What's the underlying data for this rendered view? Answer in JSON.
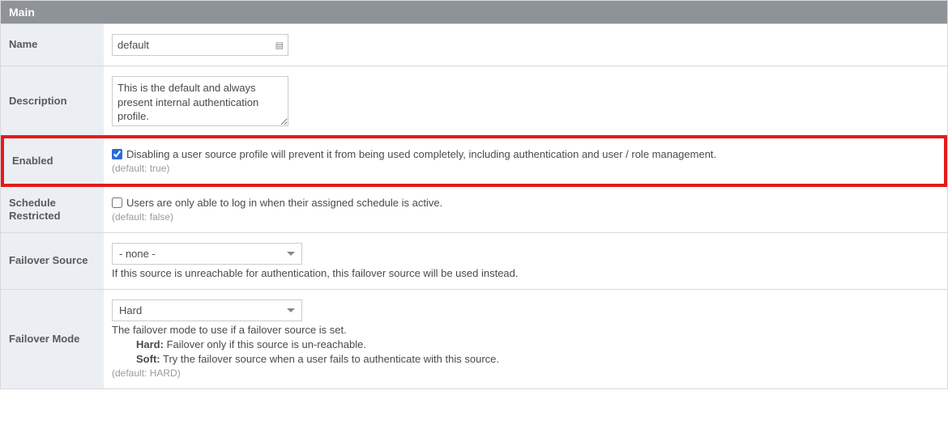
{
  "panel": {
    "title": "Main"
  },
  "fields": {
    "name": {
      "label": "Name",
      "value": "default"
    },
    "description": {
      "label": "Description",
      "value": "This is the default and always present internal authentication profile."
    },
    "enabled": {
      "label": "Enabled",
      "checked": true,
      "desc": "Disabling a user source profile will prevent it from being used completely, including authentication and user / role management.",
      "default_text": "(default: true)"
    },
    "schedule_restricted": {
      "label": "Schedule Restricted",
      "checked": false,
      "desc": "Users are only able to log in when their assigned schedule is active.",
      "default_text": "(default: false)"
    },
    "failover_source": {
      "label": "Failover Source",
      "selected": "- none -",
      "desc": "If this source is unreachable for authentication, this failover source will be used instead."
    },
    "failover_mode": {
      "label": "Failover Mode",
      "selected": "Hard",
      "desc": "The failover mode to use if a failover source is set.",
      "hard_label": "Hard:",
      "hard_desc": " Failover only if this source is un-reachable.",
      "soft_label": "Soft:",
      "soft_desc": " Try the failover source when a user fails to authenticate with this source.",
      "default_text": "(default: HARD)"
    }
  }
}
